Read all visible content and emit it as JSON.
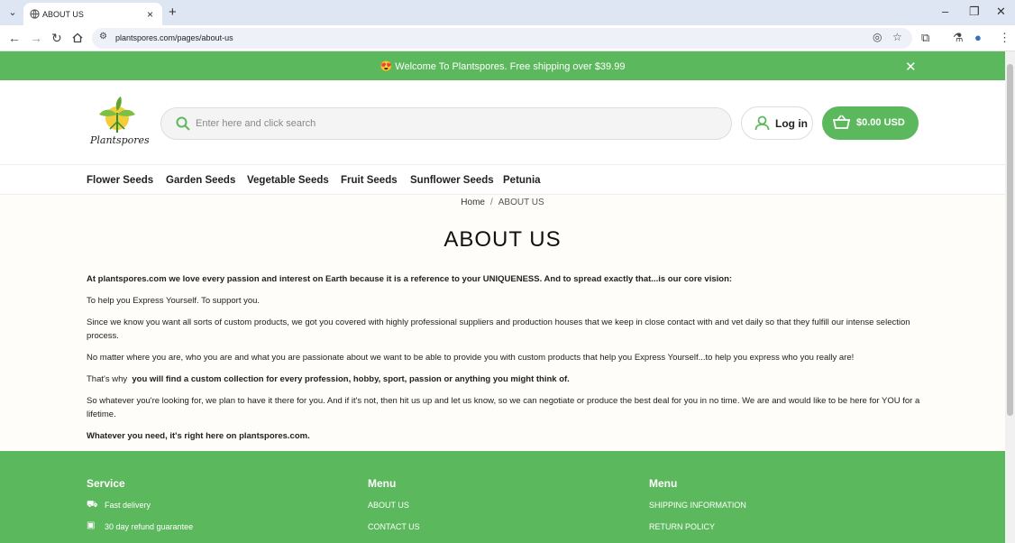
{
  "browser": {
    "tab_title": "ABOUT US",
    "url": "plantspores.com/pages/about-us"
  },
  "announcement": {
    "emoji": "😍",
    "text": "Welcome To Plantspores. Free shipping over $39.99"
  },
  "header": {
    "logo_text": "Plantspores",
    "search_placeholder": "Enter here and click search",
    "login_label": "Log in",
    "cart_label": "$0.00 USD"
  },
  "nav": {
    "items": [
      "Flower Seeds",
      "Garden Seeds",
      "Vegetable Seeds",
      "Fruit Seeds",
      "Sunflower Seeds",
      "Petunia"
    ]
  },
  "breadcrumb": {
    "home": "Home",
    "separator": "/",
    "current": "ABOUT US"
  },
  "page": {
    "title": "ABOUT US",
    "paragraphs": [
      "At plantspores.com we love every passion and interest on Earth because it is a reference to your UNIQUENESS. And to spread exactly that...is our core vision:",
      "To help you Express Yourself. To support you.",
      "Since we know you want all sorts of custom products, we got you covered with highly professional suppliers and production houses that we keep in close contact with and vet daily so that they fulfill our intense selection process.",
      "No matter where you are, who you are and what you are passionate about we want to be able to provide you with custom products that help you Express Yourself...to help you express who you really are!",
      "That's why",
      "you will find a custom collection for every profession, hobby, sport, passion or anything you might think of.",
      "So whatever you're looking for, we plan to have it there for you. And if it's not, then hit us up and let us know, so we can negotiate or produce the best deal for you in no time. We are and would like to be here for YOU for a lifetime.",
      "Whatever you need, it's right here on plantspores.com."
    ]
  },
  "footer": {
    "service": {
      "heading": "Service",
      "items": [
        "Fast delivery",
        "30 day refund guarantee"
      ]
    },
    "menu1": {
      "heading": "Menu",
      "items": [
        "ABOUT US",
        "CONTACT US"
      ]
    },
    "menu2": {
      "heading": "Menu",
      "items": [
        "SHIPPING INFORMATION",
        "RETURN POLICY"
      ]
    }
  },
  "colors": {
    "accent": "#5cb85c"
  }
}
